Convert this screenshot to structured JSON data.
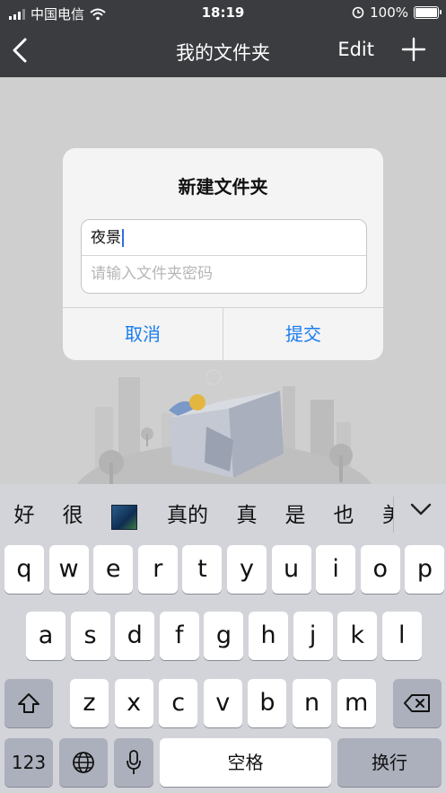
{
  "status_bar": {
    "carrier": "中国电信",
    "time": "18:19",
    "battery": "100%"
  },
  "nav": {
    "title": "我的文件夹",
    "edit_label": "Edit"
  },
  "dialog": {
    "title": "新建文件夹",
    "name_value": "夜景",
    "password_placeholder": "请输入文件夹密码",
    "cancel_label": "取消",
    "submit_label": "提交"
  },
  "keyboard": {
    "candidates": [
      "好",
      "很",
      "真的",
      "真",
      "是",
      "也",
      "美"
    ],
    "row1": [
      "q",
      "w",
      "e",
      "r",
      "t",
      "y",
      "u",
      "i",
      "o",
      "p"
    ],
    "row2": [
      "a",
      "s",
      "d",
      "f",
      "g",
      "h",
      "j",
      "k",
      "l"
    ],
    "row3": [
      "z",
      "x",
      "c",
      "v",
      "b",
      "n",
      "m"
    ],
    "numbers_label": "123",
    "space_label": "空格",
    "return_label": "换行"
  },
  "icons": [
    "wifi-icon",
    "alarm-icon",
    "battery-icon",
    "back-icon",
    "plus-icon",
    "chevron-down-icon",
    "shift-icon",
    "delete-icon",
    "globe-icon",
    "mic-icon"
  ]
}
